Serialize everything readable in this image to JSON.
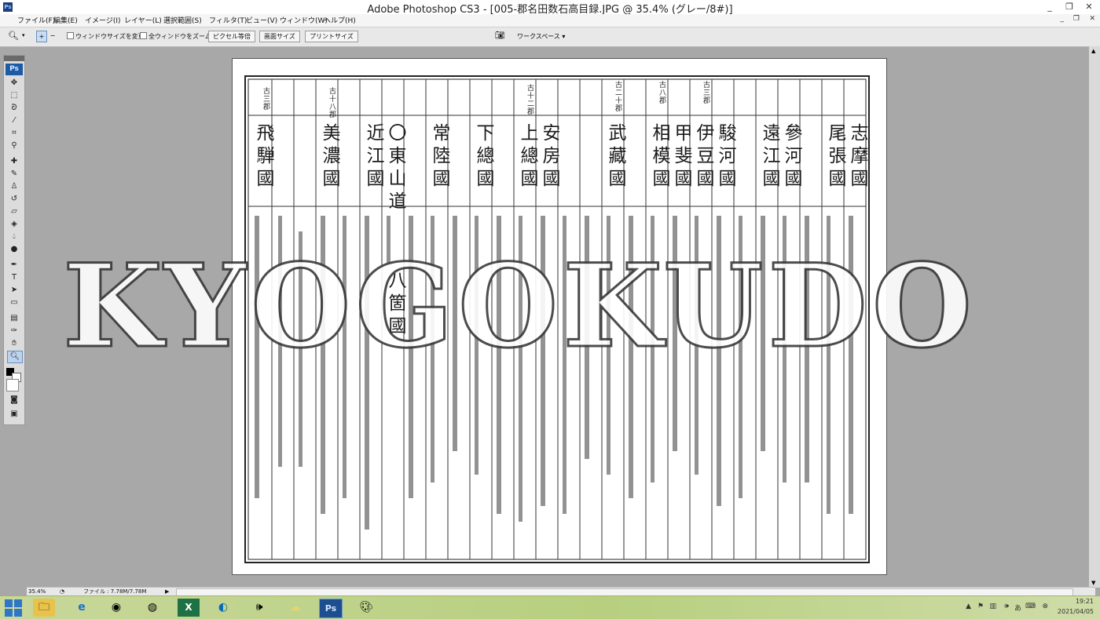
{
  "window": {
    "title": "Adobe Photoshop CS3 - [005-郡名田数石高目録.JPG @ 35.4% (グレー/8#)]",
    "app_icon": "Ps",
    "controls": [
      "_",
      "❐",
      "✕"
    ]
  },
  "menubar": {
    "items": [
      "ファイル(F)",
      "編集(E)",
      "イメージ(I)",
      "レイヤー(L)",
      "選択範囲(S)",
      "フィルタ(T)",
      "ビュー(V)",
      "ウィンドウ(W)",
      "ヘルプ(H)"
    ],
    "doc_controls": [
      "_",
      "❐",
      "✕"
    ]
  },
  "options": {
    "checkbox_resize": "ウィンドウサイズを変更",
    "checkbox_zoom_all": "全ウィンドウをズーム",
    "btn_actual_pixels": "ピクセル等倍",
    "btn_fit_screen": "画面サイズ",
    "btn_print_size": "プリントサイズ",
    "workspace": "ワークスペース ▾"
  },
  "toolbox": {
    "logo": "Ps",
    "tools": [
      "move-icon",
      "marquee-icon",
      "lasso-icon",
      "magic-wand-icon",
      "crop-icon",
      "eyedropper-icon",
      "healing-icon",
      "brush-icon",
      "stamp-icon",
      "history-brush-icon",
      "eraser-icon",
      "bucket-icon",
      "blur-icon",
      "dodge-icon",
      "pen-icon",
      "type-icon",
      "path-select-icon",
      "shape-icon",
      "notes-icon",
      "eyedropper2-icon",
      "hand-icon",
      "zoom-icon"
    ]
  },
  "document": {
    "headers_small": [
      "古三郡",
      "古十八郡",
      "古十二郡",
      "古二十郡",
      "古八郡",
      "古三郡"
    ],
    "provinces": [
      "飛騨國",
      "美濃國",
      "近江國",
      "〇東山道",
      "常陸國",
      "下總國",
      "上總國",
      "安房國",
      "武藏國",
      "相模國",
      "甲斐國",
      "伊豆國",
      "駿河國",
      "遠江國",
      "參河國",
      "尾張國",
      "志摩國"
    ],
    "eight_provinces": "八箇國"
  },
  "watermark": "KYOGOKUDO",
  "status": {
    "zoom": "35.4%",
    "file_info": "ファイル : 7.78M/7.78M"
  },
  "taskbar": {
    "time": "19:21",
    "date": "2021/04/05"
  }
}
